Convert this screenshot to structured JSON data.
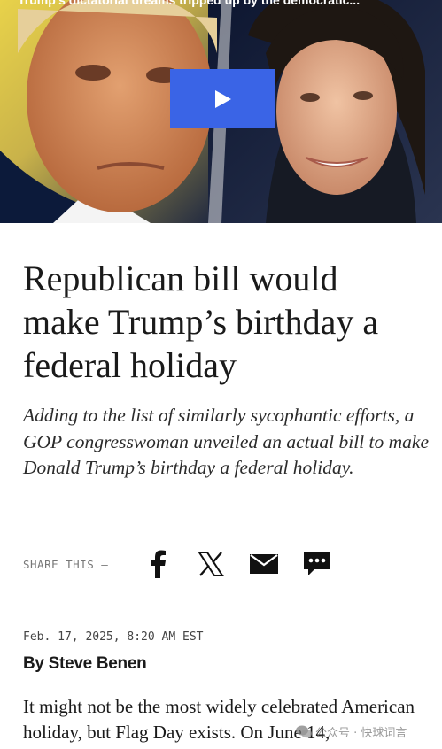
{
  "video": {
    "caption": "Trump's dictatorial dreams tripped up by the democratic...",
    "play_icon": "play-icon"
  },
  "article": {
    "headline": "Republican bill would make Trump’s birthday a federal holiday",
    "dek": "Adding to the list of similarly sycophantic efforts, a GOP congresswoman unveiled an actual bill to make Donald Trump’s birthday a federal holiday.",
    "date": "Feb. 17, 2025, 8:20 AM EST",
    "byline": "By Steve Benen",
    "body": "It might not be the most widely celebrated American holiday, but Flag Day exists. On June 14,"
  },
  "share": {
    "label": "SHARE THIS —",
    "buttons": [
      {
        "name": "facebook",
        "icon": "facebook-icon"
      },
      {
        "name": "x",
        "icon": "x-icon"
      },
      {
        "name": "email",
        "icon": "email-icon"
      },
      {
        "name": "sms",
        "icon": "chat-icon"
      }
    ]
  },
  "watermark": {
    "text": "公众号 · 快球词言",
    "icon": "wechat-icon"
  },
  "colors": {
    "play_button": "#3a64e6",
    "text": "#1a1a1a",
    "muted": "#777777"
  }
}
